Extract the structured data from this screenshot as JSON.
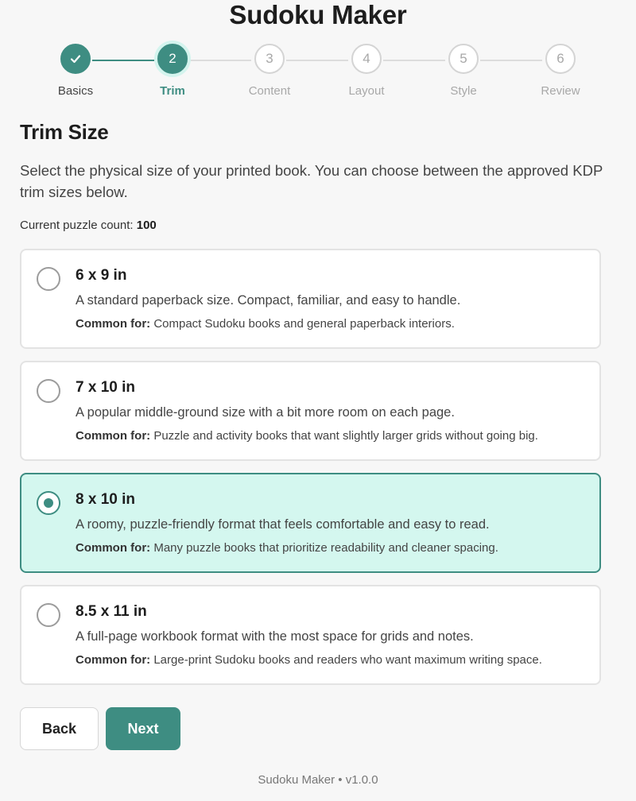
{
  "app": {
    "title": "Sudoku Maker"
  },
  "stepper": {
    "steps": [
      {
        "number": "",
        "label": "Basics",
        "state": "complete"
      },
      {
        "number": "2",
        "label": "Trim",
        "state": "current"
      },
      {
        "number": "3",
        "label": "Content",
        "state": "upcoming"
      },
      {
        "number": "4",
        "label": "Layout",
        "state": "upcoming"
      },
      {
        "number": "5",
        "label": "Style",
        "state": "upcoming"
      },
      {
        "number": "6",
        "label": "Review",
        "state": "upcoming"
      }
    ]
  },
  "section": {
    "title": "Trim Size",
    "description": "Select the physical size of your printed book. You can choose between the approved KDP trim sizes below.",
    "puzzle_count_label": "Current puzzle count:",
    "puzzle_count_value": "100"
  },
  "options": [
    {
      "name": "6 x 9 in",
      "blurb": "A standard paperback size. Compact, familiar, and easy to handle.",
      "common_label": "Common for:",
      "common_text": "Compact Sudoku books and general paperback interiors.",
      "selected": false
    },
    {
      "name": "7 x 10 in",
      "blurb": "A popular middle-ground size with a bit more room on each page.",
      "common_label": "Common for:",
      "common_text": "Puzzle and activity books that want slightly larger grids without going big.",
      "selected": false
    },
    {
      "name": "8 x 10 in",
      "blurb": "A roomy, puzzle-friendly format that feels comfortable and easy to read.",
      "common_label": "Common for:",
      "common_text": "Many puzzle books that prioritize readability and cleaner spacing.",
      "selected": true
    },
    {
      "name": "8.5 x 11 in",
      "blurb": "A full-page workbook format with the most space for grids and notes.",
      "common_label": "Common for:",
      "common_text": "Large-print Sudoku books and readers who want maximum writing space.",
      "selected": false
    }
  ],
  "buttons": {
    "back": "Back",
    "next": "Next"
  },
  "footer": {
    "text": "Sudoku Maker • v1.0.0"
  },
  "colors": {
    "accent": "#3e8d82",
    "selected_bg": "#d4f7ef",
    "current_ring": "#d4f4ee"
  }
}
